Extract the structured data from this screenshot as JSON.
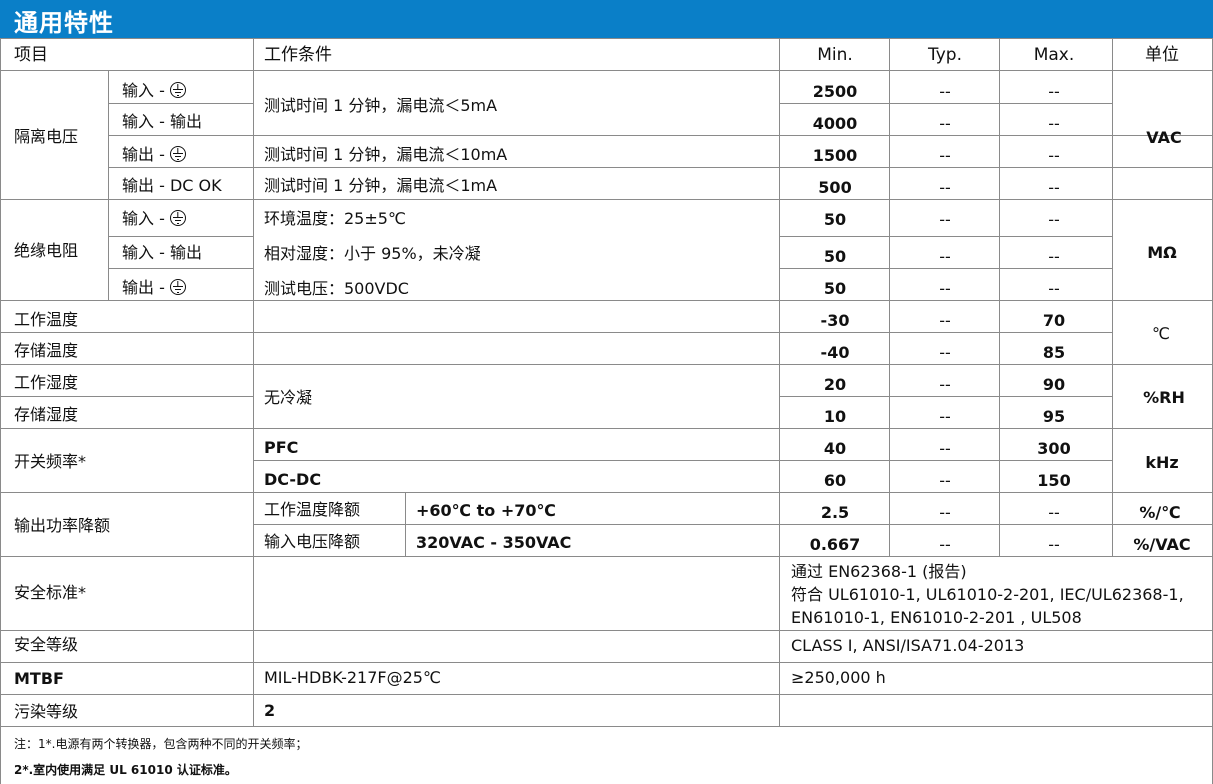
{
  "title": "通用特性",
  "header": {
    "item": "项目",
    "condition": "工作条件",
    "min": "Min.",
    "typ": "Typ.",
    "max": "Max.",
    "unit": "单位"
  },
  "isolation": {
    "label": "隔离电压",
    "rows": [
      {
        "sub": "输入 -",
        "cond": "",
        "min": "2500",
        "typ": "--",
        "max": "--"
      },
      {
        "sub": "输入 - 输出",
        "cond": "",
        "min": "4000",
        "typ": "--",
        "max": "--"
      },
      {
        "sub": "输出 -",
        "cond": "测试时间 1 分钟，漏电流＜10mA",
        "min": "1500",
        "typ": "--",
        "max": "--"
      },
      {
        "sub": "输出 - DC OK",
        "cond": "测试时间 1 分钟，漏电流＜1mA",
        "min": "500",
        "typ": "--",
        "max": "--"
      }
    ],
    "cond_merged": "测试时间 1 分钟，漏电流＜5mA",
    "unit": "VAC"
  },
  "insulation": {
    "label": "绝缘电阻",
    "rows": [
      {
        "sub": "输入 -",
        "cond": "环境温度：25±5℃",
        "min": "50",
        "typ": "--",
        "max": "--"
      },
      {
        "sub": "输入 - 输出",
        "cond": "相对湿度：小于 95%，未冷凝",
        "min": "50",
        "typ": "--",
        "max": "--"
      },
      {
        "sub": "输出 -",
        "cond": "测试电压：500VDC",
        "min": "50",
        "typ": "--",
        "max": "--"
      }
    ],
    "unit": "MΩ"
  },
  "temperature": {
    "rows": [
      {
        "label": "工作温度",
        "min": "-30",
        "typ": "--",
        "max": "70"
      },
      {
        "label": "存储温度",
        "min": "-40",
        "typ": "--",
        "max": "85"
      }
    ],
    "unit": "℃"
  },
  "humidity": {
    "rows": [
      {
        "label": "工作湿度",
        "min": "20",
        "typ": "--",
        "max": "90"
      },
      {
        "label": "存储湿度",
        "min": "10",
        "typ": "--",
        "max": "95"
      }
    ],
    "cond": "无冷凝",
    "unit": "%RH"
  },
  "frequency": {
    "label": "开关频率*",
    "rows": [
      {
        "cond": "PFC",
        "min": "40",
        "typ": "--",
        "max": "300"
      },
      {
        "cond": "DC-DC",
        "min": "60",
        "typ": "--",
        "max": "150"
      }
    ],
    "unit": "kHz"
  },
  "derating": {
    "label": "输出功率降额",
    "rows": [
      {
        "cond": "工作温度降额",
        "range": "+60℃ to +70℃",
        "min": "2.5",
        "typ": "--",
        "max": "--",
        "unit": "%/℃"
      },
      {
        "cond": "输入电压降额",
        "range": "320VAC - 350VAC",
        "min": "0.667",
        "typ": "--",
        "max": "--",
        "unit": "%/VAC"
      }
    ]
  },
  "safety_std": {
    "label": "安全标准*",
    "line1": "通过 EN62368-1 (报告)",
    "line2": "符合 UL61010-1, UL61010-2-201, IEC/UL62368-1,",
    "line3": "EN61010-1, EN61010-2-201 , UL508"
  },
  "safety_class": {
    "label": "安全等级",
    "value": "CLASS I, ANSI/ISA71.04-2013"
  },
  "mtbf": {
    "label": "MTBF",
    "cond": "MIL-HDBK-217F@25℃",
    "value": "≥250,000 h"
  },
  "pollution": {
    "label": "污染等级",
    "value": "2"
  },
  "notes": {
    "line1": "注：1*.电源有两个转换器，包含两种不同的开关频率；",
    "line2": "2*.室内使用满足 UL 61010 认证标准。"
  },
  "colors": {
    "banner": "#0a7fc8",
    "grid": "#8a8a8a"
  }
}
